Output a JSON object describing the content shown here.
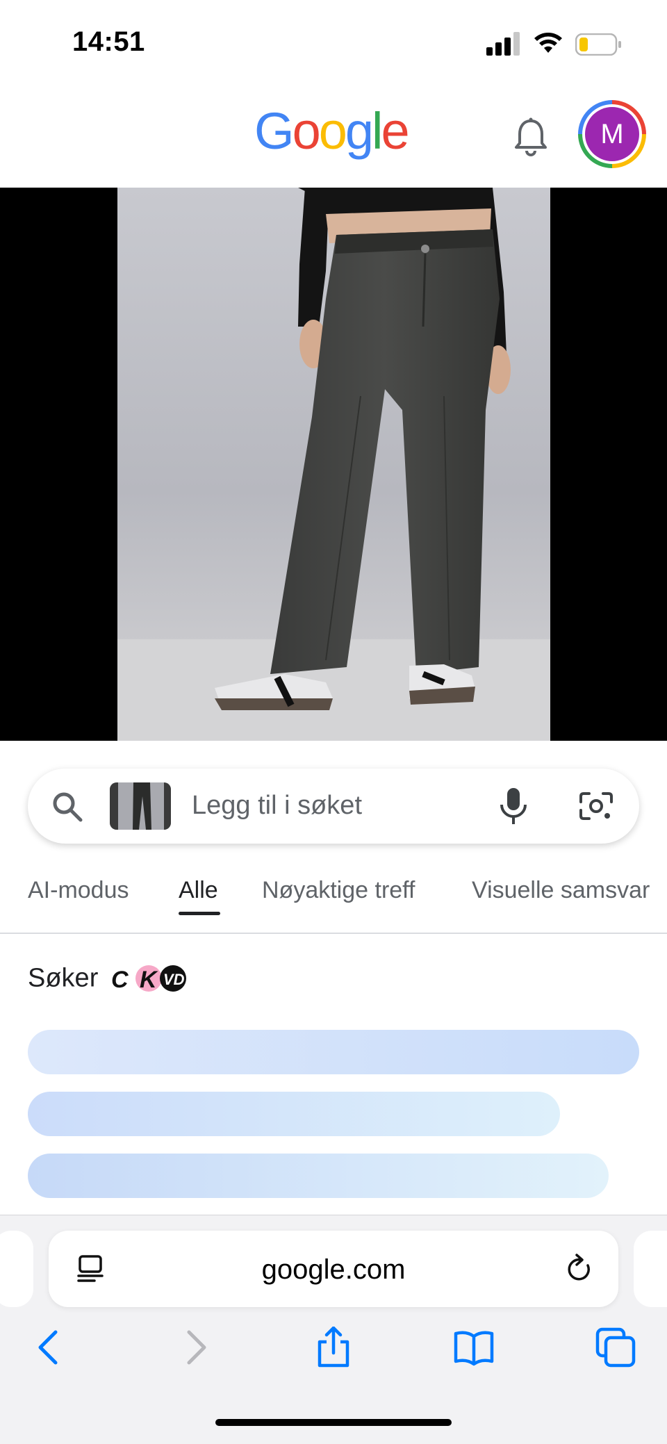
{
  "status_bar": {
    "time": "14:51",
    "icons": [
      "cellular-signal-icon",
      "wifi-icon",
      "battery-low-icon"
    ]
  },
  "header": {
    "logo_letters": [
      "G",
      "o",
      "o",
      "g",
      "l",
      "e"
    ],
    "logo_colors": [
      "#4285f4",
      "#ea4335",
      "#fbbc05",
      "#4285f4",
      "#34a853",
      "#ea4335"
    ],
    "avatar_initial": "M",
    "avatar_color": "#9c27b0"
  },
  "search": {
    "placeholder": "Legg til i søket"
  },
  "tabs": [
    {
      "label": "AI-modus",
      "active": false
    },
    {
      "label": "Alle",
      "active": true
    },
    {
      "label": "Nøyaktige treff",
      "active": false
    },
    {
      "label": "Visuelle samsvar",
      "active": false
    }
  ],
  "results": {
    "searching_label": "Søker",
    "brand_logo_text": [
      "C",
      "K",
      "VD"
    ]
  },
  "browser": {
    "url": "google.com"
  },
  "colors": {
    "accent_blue": "#007aff",
    "skeleton_blue": "#c8dcfa",
    "tab_active": "#202124",
    "tab_inactive": "#5f6368"
  }
}
